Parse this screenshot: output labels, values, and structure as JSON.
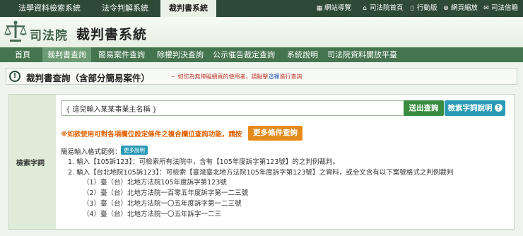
{
  "top_tabs": [
    "法學資料檢索系統",
    "法令判解系統",
    "裁判書系統"
  ],
  "utilities": [
    {
      "icon": "sitemap-icon",
      "label": "網站導覽"
    },
    {
      "icon": "home-icon",
      "label": "司法院首頁"
    },
    {
      "icon": "mobile-icon",
      "label": "行動版"
    },
    {
      "icon": "zoom-icon",
      "label": "網頁縮放"
    },
    {
      "icon": "mail-icon",
      "label": "司法信箱"
    }
  ],
  "header": {
    "logo_text": "司法院",
    "title": "裁判書系統"
  },
  "nav": [
    "首頁",
    "裁判書查詢",
    "簡易案件查詢",
    "除權判決查詢",
    "公示催告裁定查詢",
    "系統說明",
    "司法院資料開放平臺"
  ],
  "page": {
    "title": "裁判書查詢（含部分簡易案件）",
    "note_prefix": "－ 如您為無障礙網頁的使用者，請點擊",
    "note_link": "這裡",
    "note_suffix": "進行查詢"
  },
  "search": {
    "label": "檢索字詞",
    "value": "{ 這兒輸入某某事業主名稱 }",
    "submit": "送出查詢",
    "help": "檢索字詞說明",
    "help_icon": "?"
  },
  "advanced": {
    "warning": "※如欲使用可對各項欄位設定條件之複合欄位查詢功能，請按",
    "button": "更多條件查詢"
  },
  "examples": {
    "label": "簡易輸入格式範例：",
    "more": "更多說明",
    "line1": "1. 輸入【105訴123】：可檢索所有法院中，含有【105年度訴字第123號】的之判例裁判。",
    "line2": "2. 輸入【台北地院105訴123】：可檢索【臺灣臺北地方法院105年度訴字第123號】之資料，或全文含有以下案號格式之判例裁判",
    "subs": [
      "（1）臺（台）北地方法院105年度訴字第123號",
      "（2）臺（台）北地方法院一百零五年度訴字第一二三號",
      "（3）臺（台）北地方法院一〇五年度訴字第一二三號",
      "（4）臺（台）北地方法院一〇五年訴字一二三"
    ]
  }
}
